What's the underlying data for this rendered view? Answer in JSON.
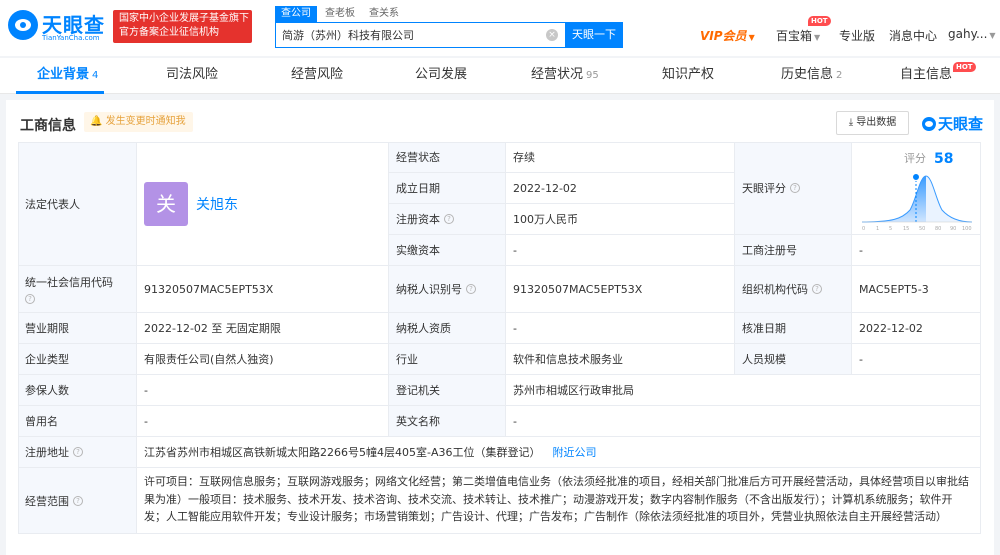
{
  "header": {
    "logo_cn": "天眼查",
    "logo_en": "TianYanCha.com",
    "gov_line1": "国家中小企业发展子基金旗下",
    "gov_line2": "官方备案企业征信机构",
    "search_tabs": [
      "查公司",
      "查老板",
      "查关系"
    ],
    "search_value": "简游（苏州）科技有限公司",
    "search_clear": "×",
    "search_button": "天眼一下",
    "vip": "VIP会员",
    "treasure": "百宝箱",
    "hot": "HOT",
    "pro": "专业版",
    "messages": "消息中心",
    "user": "gahy..."
  },
  "tabs": [
    {
      "label": "企业背景",
      "count": "4"
    },
    {
      "label": "司法风险",
      "count": ""
    },
    {
      "label": "经营风险",
      "count": ""
    },
    {
      "label": "公司发展",
      "count": ""
    },
    {
      "label": "经营状况",
      "count": "95"
    },
    {
      "label": "知识产权",
      "count": ""
    },
    {
      "label": "历史信息",
      "count": "2"
    },
    {
      "label": "自主信息",
      "count": ""
    }
  ],
  "section": {
    "title": "工商信息",
    "notify": "发生变更时通知我",
    "export": "导出数据",
    "brand": "天眼查"
  },
  "info": {
    "legal_rep_label": "法定代表人",
    "legal_rep_avatar": "关",
    "legal_rep_name": "关旭东",
    "status_label": "经营状态",
    "status_value": "存续",
    "found_label": "成立日期",
    "found_value": "2022-12-02",
    "reg_capital_label": "注册资本",
    "reg_capital_value": "100万人民币",
    "paid_capital_label": "实缴资本",
    "paid_capital_value": "-",
    "score_label": "天眼评分",
    "score_text": "评分",
    "score_value": "58",
    "score_ticks": [
      "0",
      "1",
      "5",
      "15",
      "50",
      "80",
      "90",
      "100"
    ],
    "reg_no_label": "工商注册号",
    "reg_no_value": "-",
    "credit_code_label": "统一社会信用代码",
    "credit_code_value": "91320507MAC5EPT53X",
    "taxpayer_id_label": "纳税人识别号",
    "taxpayer_id_value": "91320507MAC5EPT53X",
    "org_code_label": "组织机构代码",
    "org_code_value": "MAC5EPT5-3",
    "term_label": "营业期限",
    "term_value": "2022-12-02 至 无固定期限",
    "taxpayer_qual_label": "纳税人资质",
    "taxpayer_qual_value": "-",
    "approve_date_label": "核准日期",
    "approve_date_value": "2022-12-02",
    "type_label": "企业类型",
    "type_value": "有限责任公司(自然人独资)",
    "industry_label": "行业",
    "industry_value": "软件和信息技术服务业",
    "staff_label": "人员规模",
    "staff_value": "-",
    "insured_label": "参保人数",
    "insured_value": "-",
    "authority_label": "登记机关",
    "authority_value": "苏州市相城区行政审批局",
    "former_name_label": "曾用名",
    "former_name_value": "-",
    "en_name_label": "英文名称",
    "en_name_value": "-",
    "address_label": "注册地址",
    "address_value": "江苏省苏州市相城区高铁新城太阳路2266号5幢4层405室-A36工位（集群登记）",
    "nearby": "附近公司",
    "scope_label": "经营范围",
    "scope_value": "许可项目：互联网信息服务；互联网游戏服务；网络文化经营；第二类增值电信业务（依法须经批准的项目，经相关部门批准后方可开展经营活动，具体经营项目以审批结果为准）一般项目：技术服务、技术开发、技术咨询、技术交流、技术转让、技术推广；动漫游戏开发；数字内容制作服务（不含出版发行）；计算机系统服务；软件开发；人工智能应用软件开发；专业设计服务；市场营销策划；广告设计、代理；广告发布；广告制作（除依法须经批准的项目外，凭营业执照依法自主开展经营活动）"
  },
  "colors": {
    "brand": "#0084ff",
    "gov_red": "#e5322d",
    "vip": "#ff6a00",
    "avatar": "#b392e6"
  }
}
